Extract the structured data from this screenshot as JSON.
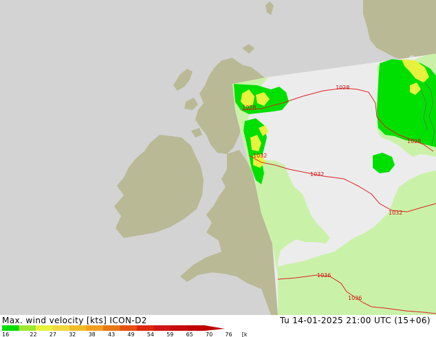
{
  "map": {
    "isobars": [
      {
        "label": "1028"
      },
      {
        "label": "1028"
      },
      {
        "label": "1028"
      },
      {
        "label": "1032"
      },
      {
        "label": "1032"
      },
      {
        "label": "1032"
      },
      {
        "label": "1036"
      },
      {
        "label": "1036"
      }
    ],
    "colors": {
      "sea": "#d3d3d3",
      "land": "#b9b995",
      "domain_sea": "#ececec",
      "domain_land": "#c9f2a8",
      "wind_16": "#00e000",
      "wind_22": "#e6f23c",
      "isobar": "#e02020"
    }
  },
  "footer": {
    "title_left": "Max. wind velocity [kts] ICON-D2",
    "title_right": "Tu 14-01-2025 21:00 UTC (15+06)",
    "scale": {
      "ticks": [
        "16",
        "22",
        "27",
        "32",
        "38",
        "43",
        "49",
        "54",
        "59",
        "65",
        "70",
        "76"
      ],
      "unit": "[knots]",
      "colors": [
        "#00dc00",
        "#a0e632",
        "#e6f23c",
        "#f2d83c",
        "#f0bc28",
        "#f0a01e",
        "#e87814",
        "#e45010",
        "#dc2808",
        "#d01414",
        "#c80a0a",
        "#c00000"
      ]
    }
  }
}
